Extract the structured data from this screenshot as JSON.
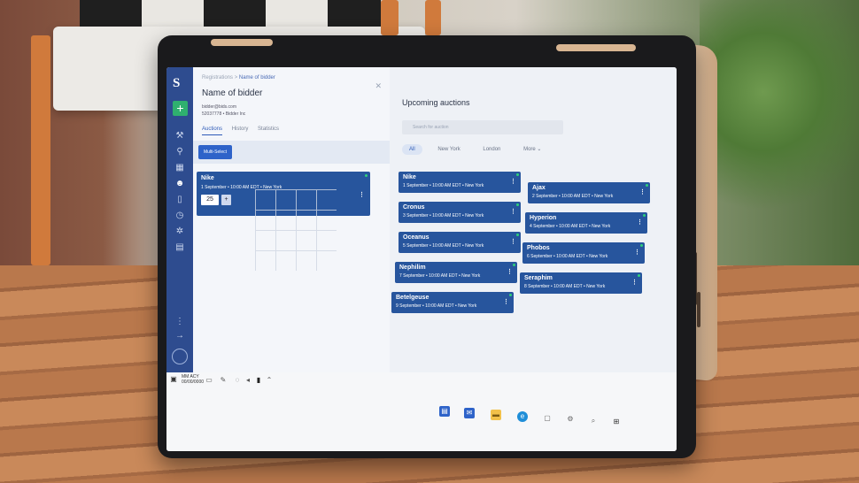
{
  "colors": {
    "accent": "#2e63c9",
    "card": "#27559d",
    "rail": "#2e4c8f",
    "live": "#2fd07a",
    "add": "#2fb06f"
  },
  "rail": {
    "logo": "S",
    "add_label": "+",
    "icons": [
      "gavel-icon",
      "location-icon",
      "calendar-icon",
      "users-icon",
      "clipboard-icon",
      "clock-icon",
      "settings-icon",
      "report-icon"
    ]
  },
  "breadcrumb": {
    "parent": "Registrations",
    "separator": ">",
    "current": "Name of bidder"
  },
  "bidder": {
    "name": "Name of bidder",
    "email": "bidder@bids.com",
    "phone": "52037778",
    "company": "Bidder Inc"
  },
  "tabs": [
    "Auctions",
    "History",
    "Statistics"
  ],
  "toolbar": {
    "multi_select": "Multi-Select"
  },
  "selected_auction": {
    "title": "Nike",
    "subtitle": "1 September • 10:00 AM EDT • New York",
    "quantity": "25",
    "step": "+"
  },
  "upcoming": {
    "title": "Upcoming auctions",
    "search_placeholder": "Search for auction",
    "filters": [
      "All",
      "New York",
      "London",
      "More"
    ],
    "left_column": [
      {
        "title": "Nike",
        "subtitle": "1 September • 10:00 AM EDT • New York"
      },
      {
        "title": "Cronus",
        "subtitle": "3 September • 10:00 AM EDT • New York"
      },
      {
        "title": "Oceanus",
        "subtitle": "5 September • 10:00 AM EDT • New York"
      },
      {
        "title": "Nephilim",
        "subtitle": "7 September • 10:00 AM EDT • New York"
      },
      {
        "title": "Betelgeuse",
        "subtitle": "9 September • 10:00 AM EDT • New York"
      }
    ],
    "right_column": [
      {
        "title": "Ajax",
        "subtitle": "2 September • 10:00 AM EDT • New York"
      },
      {
        "title": "Hyperion",
        "subtitle": "4 September • 10:00 AM EDT • New York"
      },
      {
        "title": "Phobos",
        "subtitle": "6 September • 10:00 AM EDT • New York"
      },
      {
        "title": "Seraphim",
        "subtitle": "8 September • 10:00 AM EDT • New York"
      }
    ]
  },
  "taskbar": {
    "clock_line1": "MM ACY",
    "clock_line2": "00/00/0000",
    "icons": [
      "mail-icon",
      "folder-icon",
      "edge-icon",
      "chat-icon",
      "settings-icon",
      "search-icon",
      "windows-icon"
    ]
  }
}
